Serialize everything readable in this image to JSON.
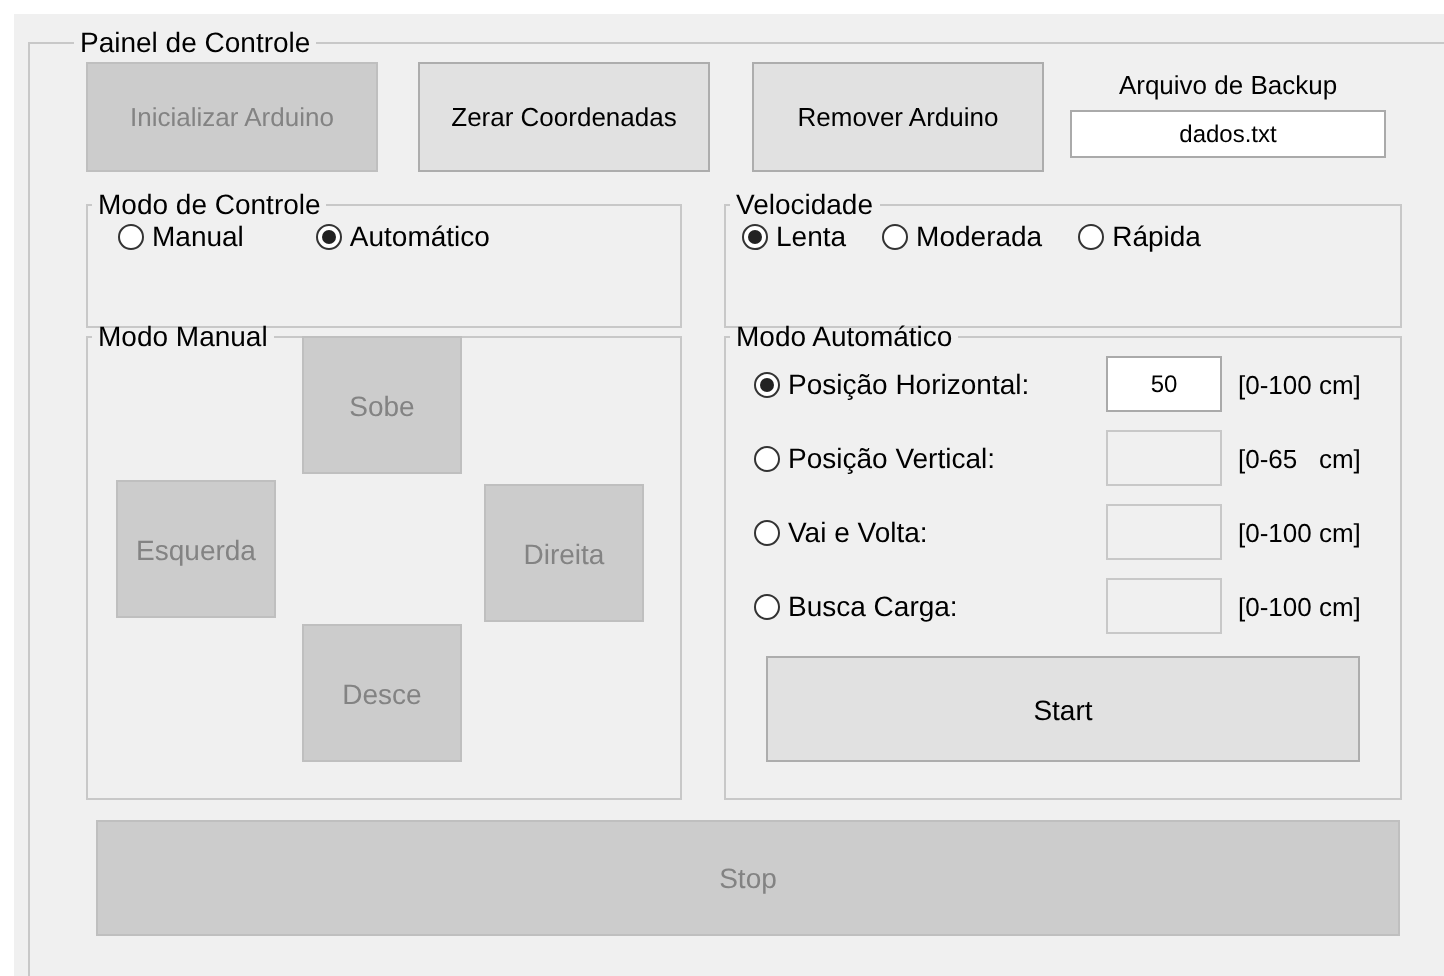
{
  "panel": {
    "title": "Painel de Controle"
  },
  "top_buttons": [
    {
      "label": "Inicializar Arduino",
      "disabled": true
    },
    {
      "label": "Zerar Coordenadas",
      "disabled": false
    },
    {
      "label": "Remover Arduino",
      "disabled": false
    }
  ],
  "backup": {
    "label": "Arquivo de Backup",
    "value": "dados.txt"
  },
  "control_mode": {
    "title": "Modo de Controle",
    "options": [
      {
        "label": "Manual",
        "selected": false
      },
      {
        "label": "Automático",
        "selected": true
      }
    ]
  },
  "speed": {
    "title": "Velocidade",
    "options": [
      {
        "label": "Lenta",
        "selected": true
      },
      {
        "label": "Moderada",
        "selected": false
      },
      {
        "label": "Rápida",
        "selected": false
      }
    ]
  },
  "manual": {
    "title": "Modo Manual",
    "buttons": [
      {
        "kind": "up",
        "label": "Sobe",
        "disabled": true
      },
      {
        "kind": "left",
        "label": "Esquerda",
        "disabled": true
      },
      {
        "kind": "right",
        "label": "Direita",
        "disabled": true
      },
      {
        "kind": "down",
        "label": "Desce",
        "disabled": true
      }
    ]
  },
  "automatic": {
    "title": "Modo Automático",
    "rows": [
      {
        "label": "Posição Horizontal:",
        "selected": true,
        "value": "50",
        "disabled": false,
        "range": "[0-100 cm]"
      },
      {
        "label": "Posição Vertical:",
        "selected": false,
        "disabled": true,
        "range": "[0-65   cm]"
      },
      {
        "label": "Vai e Volta:",
        "selected": false,
        "disabled": true,
        "range": "[0-100 cm]"
      },
      {
        "label": "Busca Carga:",
        "selected": false,
        "disabled": true,
        "range": "[0-100 cm]"
      }
    ],
    "start_button": {
      "label": "Start",
      "disabled": false
    }
  },
  "stop_button": {
    "label": "Stop",
    "disabled": true
  }
}
